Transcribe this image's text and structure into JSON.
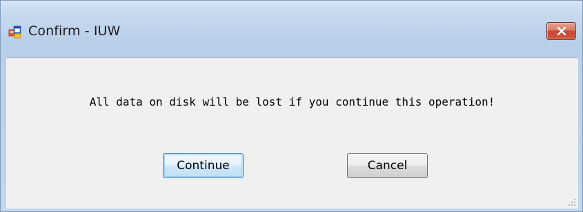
{
  "window": {
    "title": "Confirm - IUW",
    "icon": "application-icon",
    "close_icon": "close-icon",
    "accent_close": "#c7452f"
  },
  "dialog": {
    "message": "All data on disk will be lost if you continue this operation!",
    "continue_label": "Continue",
    "cancel_label": "Cancel"
  }
}
